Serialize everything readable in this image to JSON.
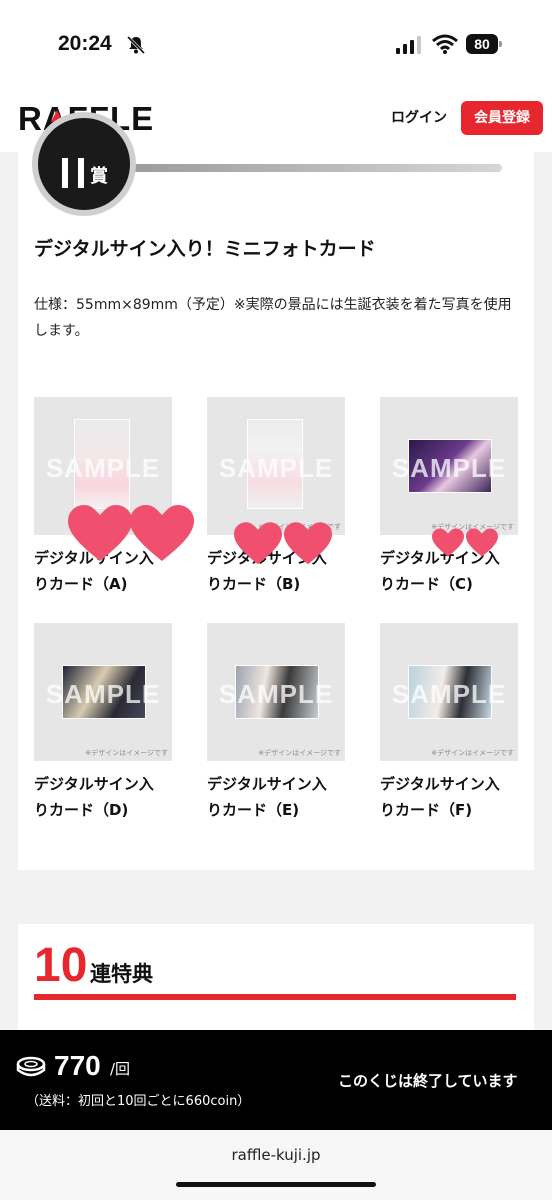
{
  "status_bar": {
    "time": "20:24",
    "battery": "80"
  },
  "header": {
    "logo": "RAFFLE",
    "login": "ログイン",
    "register": "会員登録"
  },
  "prize": {
    "rank_char": "賞",
    "title": "デジタルサイン入り！ミニフォトカード",
    "spec": "仕様：55mm×89mm（予定）※実際の景品には生誕衣装を着た写真を使用します。",
    "watermark": "SAMPLE",
    "image_note": "※デザインはイメージです",
    "items": [
      {
        "line1": "デジタルサイン入",
        "line2": "りカード（A)"
      },
      {
        "line1": "デジタルサイン入",
        "line2": "りカード（B)"
      },
      {
        "line1": "デジタルサイン入",
        "line2": "りカード（C)"
      },
      {
        "line1": "デジタルサイン入",
        "line2": "りカード（D)"
      },
      {
        "line1": "デジタルサイン入",
        "line2": "りカード（E)"
      },
      {
        "line1": "デジタルサイン入",
        "line2": "りカード（F)"
      }
    ]
  },
  "bonus": {
    "number": "10",
    "text": "連特典"
  },
  "footer": {
    "price": "770",
    "per": "/回",
    "shipping": "（送料：初回と10回ごとに660coin）",
    "status": "このくじは終了しています"
  },
  "browser": {
    "url": "raffle-kuji.jp"
  },
  "colors": {
    "accent": "#e8262e",
    "heart": "#f0506e"
  }
}
